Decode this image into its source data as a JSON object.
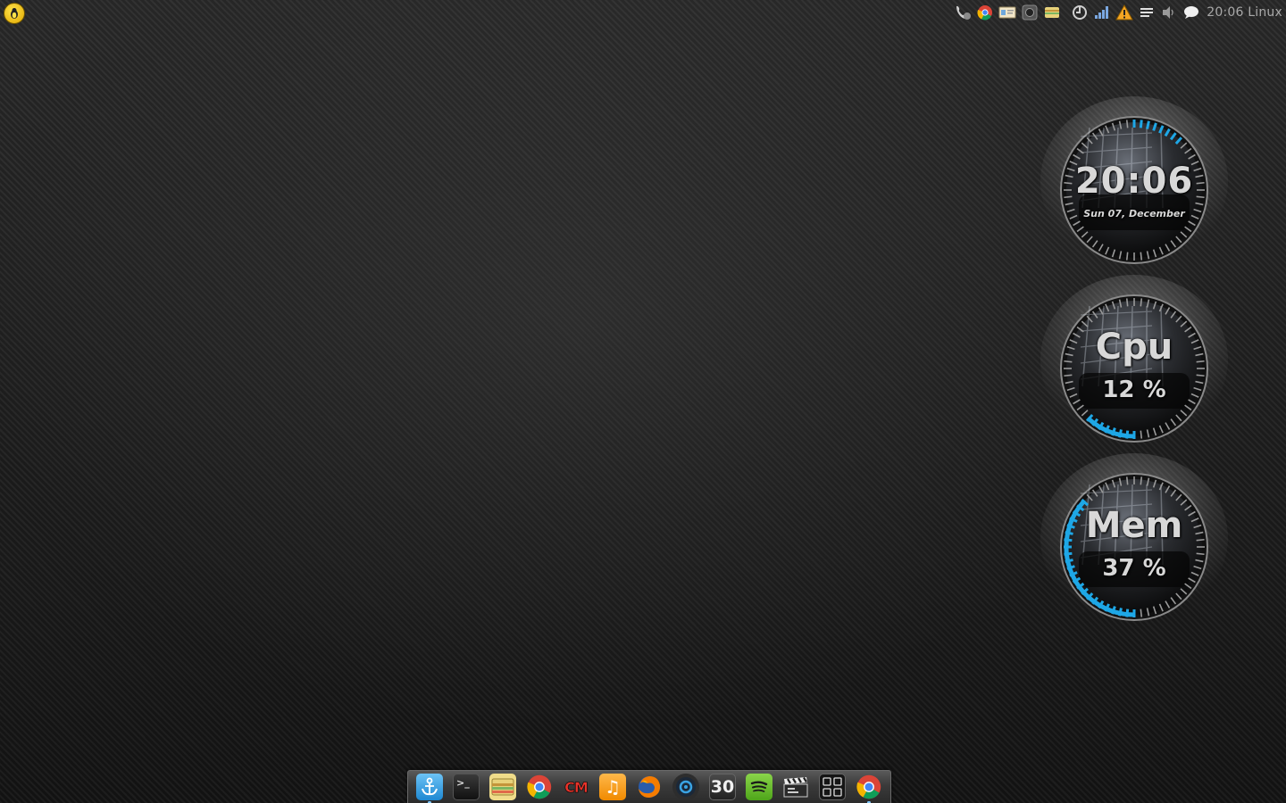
{
  "panel": {
    "clock": "20:06",
    "hostname": "Linux"
  },
  "tray_icons": [
    "call-icon",
    "chrome-icon",
    "contact-card-icon",
    "camera-icon",
    "wallet-icon",
    "update-icon",
    "signal-icon",
    "warning-icon",
    "menu-lines-icon",
    "volume-icon",
    "chat-bubble-icon"
  ],
  "widgets": {
    "clock": {
      "time": "20:06",
      "date": "Sun 07, December"
    },
    "cpu": {
      "label": "Cpu",
      "value_text": "12 %",
      "percent": 12
    },
    "mem": {
      "label": "Mem",
      "value_text": "37 %",
      "percent": 37
    }
  },
  "dock": {
    "items": [
      {
        "name": "anchor-icon",
        "text": ""
      },
      {
        "name": "terminal-icon",
        "text": ">_"
      },
      {
        "name": "wallet-icon",
        "text": ""
      },
      {
        "name": "chrome-icon",
        "text": ""
      },
      {
        "name": "cm-icon",
        "text": "CM"
      },
      {
        "name": "music-icon",
        "text": "♫"
      },
      {
        "name": "firefox-icon",
        "text": ""
      },
      {
        "name": "steam-icon",
        "text": ""
      },
      {
        "name": "calendar-icon",
        "text": "30"
      },
      {
        "name": "spotify-icon",
        "text": ""
      },
      {
        "name": "clapperboard-icon",
        "text": ""
      },
      {
        "name": "app-grid-icon",
        "text": ""
      },
      {
        "name": "chrome-icon",
        "text": ""
      }
    ]
  },
  "colors": {
    "accent": "#1ea7e6",
    "panel_text": "#a9a9a9"
  }
}
